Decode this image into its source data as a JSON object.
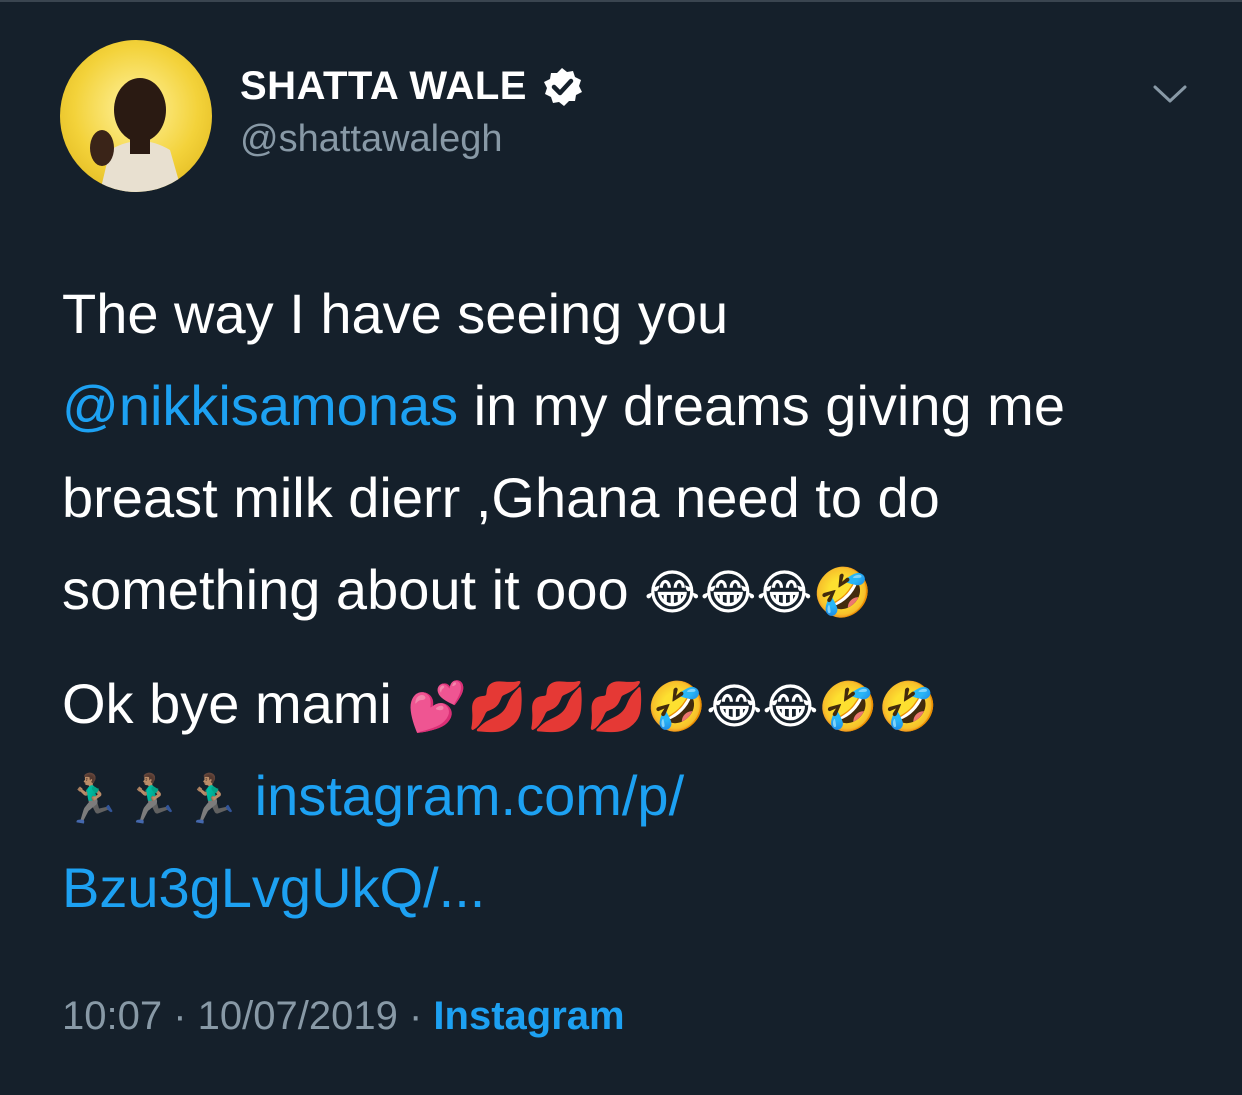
{
  "user": {
    "display_name": "SHATTA WALE",
    "handle": "@shattawalegh",
    "verified_icon": "verified-badge-icon",
    "avatar_bg": "#f3d23a"
  },
  "tweet": {
    "line1": "The way I have seeing you",
    "mention": "@nikkisamonas",
    "line2_rest": " in my dreams giving me",
    "line3": "breast milk dierr ,Ghana need to do",
    "line4_text": "something about it ooo ",
    "line4_emoji": "😂😂😂🤣",
    "line5_text": "Ok bye mami ",
    "line5_emoji": "💕💋💋💋🤣😂😂🤣🤣",
    "line6_emoji": "🏃🏽‍♂️🏃🏽‍♂️🏃🏽‍♂️ ",
    "link_part1": "instagram.com/p/",
    "link_part2": "Bzu3gLvgUkQ/..."
  },
  "meta": {
    "time": "10:07",
    "sep1": " · ",
    "date": "10/07/2019",
    "sep2": " · ",
    "source": "Instagram"
  },
  "colors": {
    "background": "#15202b",
    "accent": "#1da1f2",
    "secondary_text": "#8899a6"
  }
}
